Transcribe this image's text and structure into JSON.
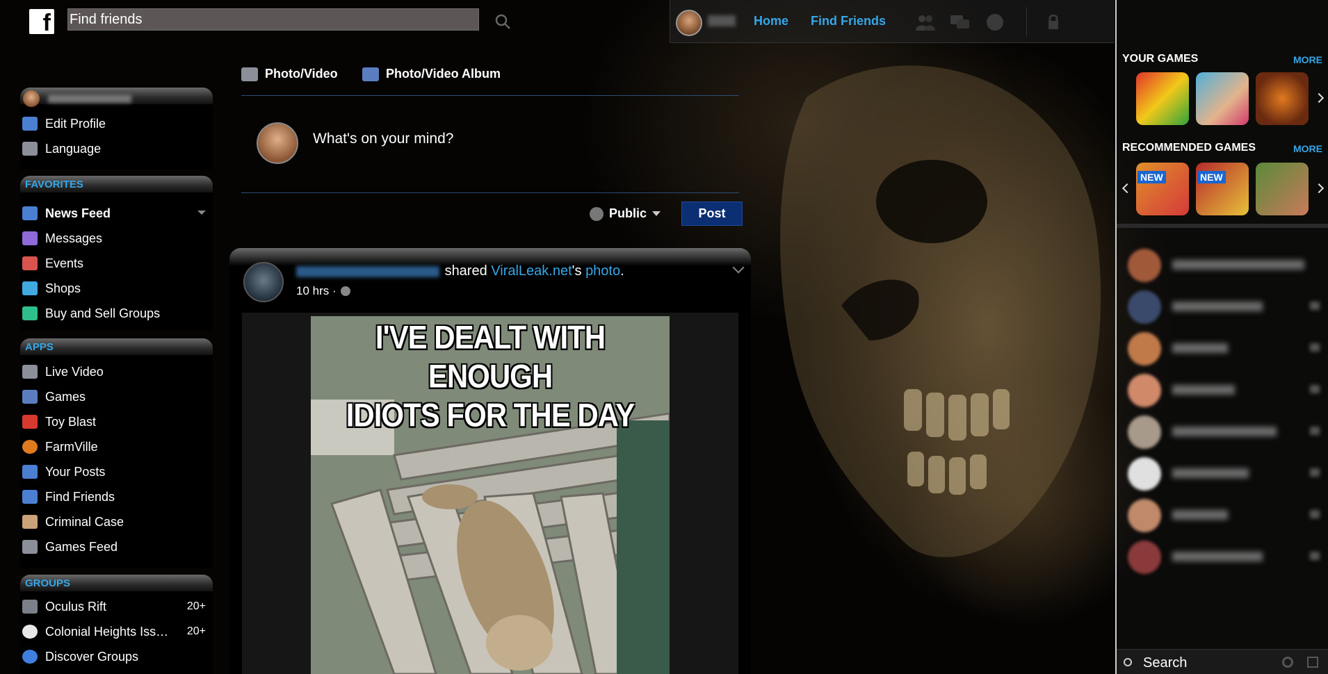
{
  "header": {
    "logo_letter": "f",
    "search_placeholder": "Find friends",
    "nav": {
      "home": "Home",
      "find_friends": "Find Friends"
    }
  },
  "sidebar": {
    "profile_items": [
      {
        "label": "Edit Profile",
        "icon": "pencil-icon",
        "color": "#4a7fd1"
      },
      {
        "label": "Language",
        "icon": "translate-icon",
        "color": "#8a8f99"
      }
    ],
    "favorites": {
      "title": "FAVORITES",
      "items": [
        {
          "label": "News Feed",
          "icon": "news-feed-icon",
          "color": "#4a7fd1"
        },
        {
          "label": "Messages",
          "icon": "messages-icon",
          "color": "#8e6ad8"
        },
        {
          "label": "Events",
          "icon": "calendar-icon",
          "color": "#d9534f"
        },
        {
          "label": "Shops",
          "icon": "shop-bag-icon",
          "color": "#3fa9e0"
        },
        {
          "label": "Buy and Sell Groups",
          "icon": "price-tag-icon",
          "color": "#2fbf8a"
        }
      ]
    },
    "apps": {
      "title": "APPS",
      "items": [
        {
          "label": "Live Video",
          "icon": "live-video-icon",
          "color": "#8a8f99"
        },
        {
          "label": "Games",
          "icon": "games-grid-icon",
          "color": "#5a7ec0"
        },
        {
          "label": "Toy Blast",
          "icon": "toy-blast-icon",
          "color": "#d63a2f"
        },
        {
          "label": "FarmVille",
          "icon": "farmville-icon",
          "color": "#e07a1f"
        },
        {
          "label": "Your Posts",
          "icon": "person-icon",
          "color": "#4a7fd1"
        },
        {
          "label": "Find Friends",
          "icon": "friends-icon",
          "color": "#4a7fd1"
        },
        {
          "label": "Criminal Case",
          "icon": "criminal-case-icon",
          "color": "#c9a27a"
        },
        {
          "label": "Games Feed",
          "icon": "gamepad-icon",
          "color": "#8a8f99"
        }
      ]
    },
    "groups": {
      "title": "GROUPS",
      "items": [
        {
          "label": "Oculus Rift",
          "count": "20+",
          "icon": "oculus-icon",
          "color": "#7a7f88"
        },
        {
          "label": "Colonial Heights Iss…",
          "count": "20+",
          "icon": "skull-icon",
          "color": "#e8e8e8"
        },
        {
          "label": "Discover Groups",
          "icon": "compass-icon",
          "color": "#3f7fe0"
        }
      ]
    }
  },
  "composer": {
    "tab_photo": "Photo/Video",
    "tab_album": "Photo/Video Album",
    "prompt": "What's on your mind?",
    "privacy": "Public",
    "post_button": "Post"
  },
  "post": {
    "shared_text": "shared",
    "source": "ViralLeak.net",
    "possessive": "'s",
    "object": "photo",
    "period": ".",
    "time": "10 hrs ·",
    "image_caption_line1": "I'VE DEALT WITH ENOUGH",
    "image_caption_line2": "IDIOTS FOR THE DAY"
  },
  "right_column": {
    "your_games_title": "YOUR GAMES",
    "recommended_title": "RECOMMENDED GAMES",
    "more": "MORE",
    "new_badge": "NEW",
    "your_games_colors": [
      "#d63a2f",
      "#4fb0d8",
      "#6a2a10"
    ],
    "recommended_colors": [
      "#e0902a",
      "#b52a2a",
      "#5a8a3a"
    ],
    "contacts_avatar_colors": [
      "#a05a3a",
      "#3a4a6a",
      "#c07a4a",
      "#d08a6a",
      "#a89a8a",
      "#e0e0e0",
      "#c08a6a",
      "#8a3a3a"
    ],
    "chat_search_placeholder": "Search"
  }
}
